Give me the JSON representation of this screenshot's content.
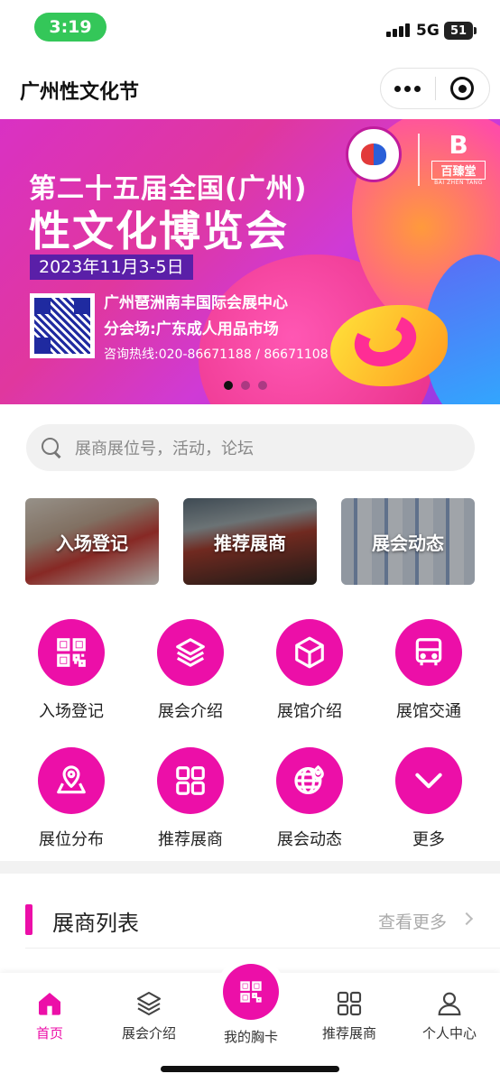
{
  "status_bar": {
    "time": "3:19",
    "network": "5G",
    "battery": "51"
  },
  "nav": {
    "title": "广州性文化节"
  },
  "banner": {
    "line1": "第二十五届全国(广州)",
    "line2": "性文化博览会",
    "date": "2023年11月3-5日",
    "venue": "广州琶洲南丰国际会展中心",
    "branch": "分会场:广东成人用品市场",
    "hotline": "咨询热线:020-86671188 / 86671108",
    "brand_name": "百臻堂",
    "brand_sub": "BAI ZHEN TANG",
    "slide_count": 3,
    "active_slide": 1
  },
  "search": {
    "placeholder": "展商展位号，活动，论坛"
  },
  "photo_cards": [
    {
      "label": "入场登记"
    },
    {
      "label": "推荐展商"
    },
    {
      "label": "展会动态"
    }
  ],
  "icon_grid": [
    {
      "label": "入场登记",
      "icon": "qr-code-icon"
    },
    {
      "label": "展会介绍",
      "icon": "layers-icon"
    },
    {
      "label": "展馆介绍",
      "icon": "cube-icon"
    },
    {
      "label": "展馆交通",
      "icon": "bus-icon"
    },
    {
      "label": "展位分布",
      "icon": "location-map-icon"
    },
    {
      "label": "推荐展商",
      "icon": "grid-icon"
    },
    {
      "label": "展会动态",
      "icon": "globe-icon"
    },
    {
      "label": "更多",
      "icon": "chevron-down-icon"
    }
  ],
  "exhibitor_list": {
    "title": "展商列表",
    "more": "查看更多"
  },
  "tab_bar": {
    "tabs": [
      {
        "label": "首页",
        "icon": "home-icon",
        "active": true
      },
      {
        "label": "展会介绍",
        "icon": "layers-icon",
        "active": false
      },
      {
        "label": "我的胸卡",
        "icon": "qr-code-icon",
        "active": false
      },
      {
        "label": "推荐展商",
        "icon": "grid-icon",
        "active": false
      },
      {
        "label": "个人中心",
        "icon": "user-icon",
        "active": false
      }
    ]
  },
  "colors": {
    "accent": "#ec0fa8",
    "status_green": "#34c759"
  }
}
